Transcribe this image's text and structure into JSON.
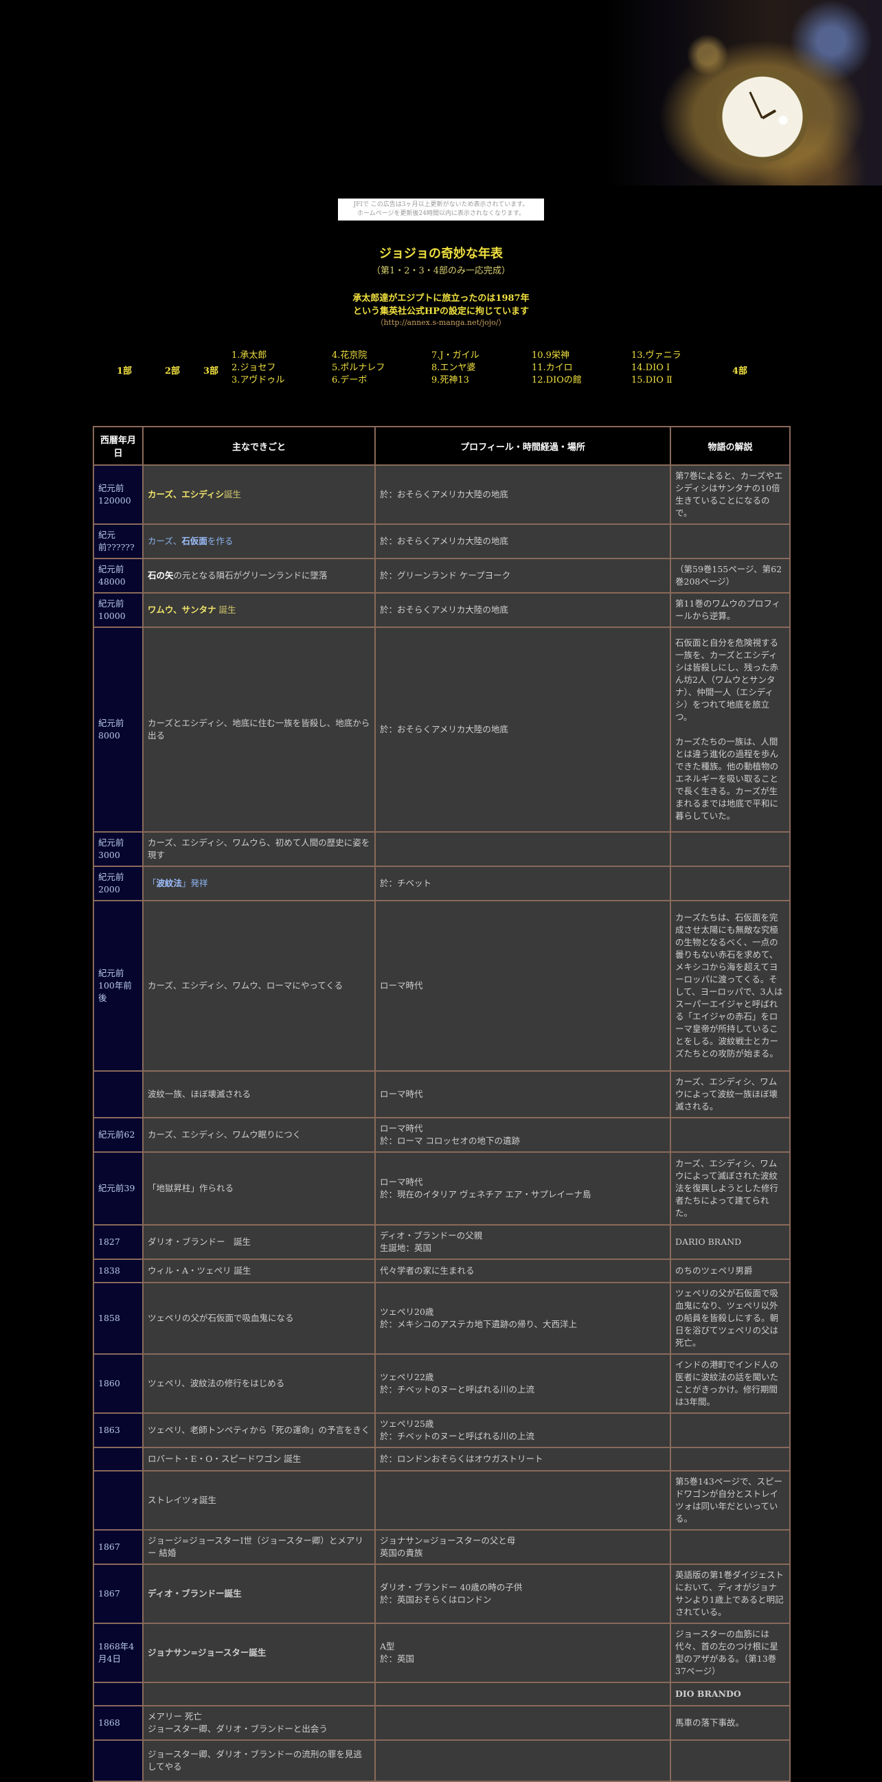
{
  "notice": {
    "line1": "JFIで この広告は3ヶ月以上更新がないため表示されています。",
    "line2": "ホームページを更新後24時間以内に表示されなくなります。"
  },
  "header": {
    "title": "ジョジョの奇妙な年表",
    "subtitle": "（第1・2・3・4部のみ一応完成）",
    "note1": "承太郎達がエジプトに旅立ったのは1987年",
    "note2": "という集英社公式HPの設定に拘じています",
    "url": "（http://annex.s-manga.net/jojo/）"
  },
  "nav": {
    "parts": [
      "1部",
      "2部",
      "3部",
      "4部"
    ],
    "col1": [
      "1.承太郎",
      "2.ジョセフ",
      "3.アヴドゥル"
    ],
    "col2": [
      "4.花京院",
      "5.ポルナレフ",
      "6.デーボ"
    ],
    "col3": [
      "7.J・ガイル",
      "8.エンヤ婆",
      "9.死神13"
    ],
    "col4": [
      "10.9栄神",
      "11.カイロ",
      "12.DIOの館"
    ],
    "col5": [
      "13.ヴァニラ",
      "14.DIO Ⅰ",
      "15.DIO Ⅱ"
    ]
  },
  "table": {
    "headers": {
      "date": "西暦年月日",
      "event": "主なできごと",
      "profile": "プロフィール・時間経過・場所",
      "explain": "物語の解説"
    },
    "rows": [
      {
        "date": "紀元前120000",
        "ev1": "カーズ、エシディシ",
        "ev2": "誕生",
        "profile": "於：おそらくアメリカ大陸の地底",
        "explain": "第7巻によると、カーズやエシディシはサンタナの10倍生きていることになるので。"
      },
      {
        "date": "紀元前??????",
        "ev1": "カーズ、",
        "ev2": "石仮面",
        "ev3": "を作る",
        "profile": "於：おそらくアメリカ大陸の地底",
        "explain": ""
      },
      {
        "date": "紀元前48000",
        "ev1": "石の矢",
        "ev2": "の元となる隕石がグリーンランドに墜落",
        "profile": "於：グリーンランド ケープヨーク",
        "explain": "（第59巻155ページ、第62巻208ページ）"
      },
      {
        "date": "紀元前10000",
        "ev1": "ワムウ、サンタナ",
        "ev2": "誕生",
        "profile": "於：おそらくアメリカ大陸の地底",
        "explain": "第11巻のワムウのプロフィールから逆算。"
      },
      {
        "date": "紀元前8000",
        "ev1": "カーズとエシディシ、地底に住む一族を皆殺し、地底から出る",
        "profile": "於：おそらくアメリカ大陸の地底",
        "explain": "石仮面と自分を危険視する一族を、カーズとエシディシは皆殺しにし、残った赤ん坊2人（ワムウとサンタナ）、仲間一人（エシディシ）をつれて地底を旅立つ。",
        "explain2": "カーズたちの一族は、人間とは違う進化の過程を歩んできた種族。他の動植物のエネルギーを吸い取ることで長く生きる。カーズが生まれるまでは地底で平和に暮らしていた。"
      },
      {
        "date": "紀元前3000",
        "ev1": "カーズ、エシディシ、ワムウら、初めて人間の歴史に姿を現す",
        "profile": "",
        "explain": ""
      },
      {
        "date": "紀元前2000",
        "ev1": "「",
        "ev2": "波紋法",
        "ev3": "」発祥",
        "profile": "於：チベット",
        "explain": ""
      },
      {
        "date": "紀元前100年前後",
        "ev1": "カーズ、エシディシ、ワムウ、ローマにやってくる",
        "profile": "ローマ時代",
        "explain": "カーズたちは、石仮面を完成させ太陽にも無敵な究極の生物となるべく、一点の曇りもない赤石を求めて、メキシコから海を超えてヨーロッパに渡ってくる。そして、ヨーロッパで、3人はスーパーエイジャと呼ばれる「エイジャの赤石」をローマ皇帝が所持していることをしる。波紋戦士とカーズたちとの攻防が始まる。"
      },
      {
        "date": "",
        "ev1": "波紋一族、ほぼ壊滅される",
        "profile": "ローマ時代",
        "explain": "カーズ、エシディシ、ワムウによって波紋一族ほぼ壊滅される。"
      },
      {
        "date": "紀元前62",
        "ev1": "カーズ、エシディシ、ワムウ眠りにつく",
        "profile": "ローマ時代",
        "profile2": "於：ローマ コロッセオの地下の遺跡",
        "explain": ""
      },
      {
        "date": "紀元前39",
        "ev1": "「地獄昇柱」作られる",
        "profile": "ローマ時代",
        "profile2": "於：現在のイタリア ヴェネチア エア・サプレイーナ島",
        "explain": "カーズ、エシディシ、ワムウによって滅ぼされた波紋法を復興しようとした修行者たちによって建てられた。"
      },
      {
        "date": "1827",
        "ev1": "ダリオ・ブランドー　誕生",
        "profile": "ディオ・ブランドーの父親",
        "profile2": "生誕地：英国",
        "explain": "DARIO BRAND"
      },
      {
        "date": "1838",
        "ev1": "ウィル・A・ツェペリ 誕生",
        "profile": "代々学者の家に生まれる",
        "explain": "のちのツェペリ男爵"
      },
      {
        "date": "1858",
        "ev1": "ツェペリの父が石仮面で吸血鬼になる",
        "profile": "ツェペリ20歳",
        "profile2": "於：メキシコのアステカ地下遺跡の帰り、大西洋上",
        "explain": "ツェペリの父が石仮面で吸血鬼になり、ツェペリ以外の船員を皆殺しにする。朝日を浴びてツェペリの父は死亡。"
      },
      {
        "date": "1860",
        "ev1": "ツェペリ、波紋法の修行をはじめる",
        "profile": "ツェペリ22歳",
        "profile2": "於：チベットのヌーと呼ばれる川の上流",
        "explain": "インドの港町でインド人の医者に波紋法の話を聞いたことがきっかけ。修行期間は3年間。"
      },
      {
        "date": "1863",
        "ev1": "ツェペリ、老師トンペティから「死の運命」の予言をきく",
        "profile": "ツェペリ25歳",
        "profile2": "於：チベットのヌーと呼ばれる川の上流",
        "explain": ""
      },
      {
        "date": "",
        "ev1": "ロバート・E・O・スピードワゴン 誕生",
        "profile": "於：ロンドンおそらくはオウガストリート",
        "explain": ""
      },
      {
        "date": "",
        "ev1": "ストレイツォ誕生",
        "profile": "",
        "explain": "第5巻143ページで、スピードワゴンが自分とストレイツォは同い年だといっている。"
      },
      {
        "date": "1867",
        "ev1": "ジョージ=ジョースターⅠ世（ジョースター卿）とメアリー 結婚",
        "profile": "ジョナサン=ジョースターの父と母",
        "profile2": "英国の貴族",
        "explain": ""
      },
      {
        "date": "1867",
        "ev1": "ディオ・ブランドー誕生",
        "profile": "ダリオ・ブランドー 40歳の時の子供",
        "profile2": "於：英国おそらくはロンドン",
        "explain": "英語版の第1巻ダイジェストにおいて、ディオがジョナサンより1歳上であると明記されている。"
      },
      {
        "date": "1868年4月4日",
        "ev1": "ジョナサン=ジョースター誕生",
        "profile": "A型",
        "profile2": "於：英国",
        "explain": "ジョースターの血筋には代々、首の左のつけ根に星型のアザがある。（第13巻37ページ）"
      },
      {
        "date": "",
        "ev1": "",
        "profile": "",
        "explain": "DIO BRANDO"
      },
      {
        "date": "1868",
        "ev1": "メアリー 死亡",
        "ev2": "ジョースター卿、ダリオ・ブランドーと出会う",
        "profile": "",
        "explain": "馬車の落下事故。"
      },
      {
        "date": "",
        "ev1": "ジョースター卿、ダリオ・ブランドーの流刑の罪を見逃してやる",
        "profile": "",
        "explain": ""
      }
    ]
  }
}
